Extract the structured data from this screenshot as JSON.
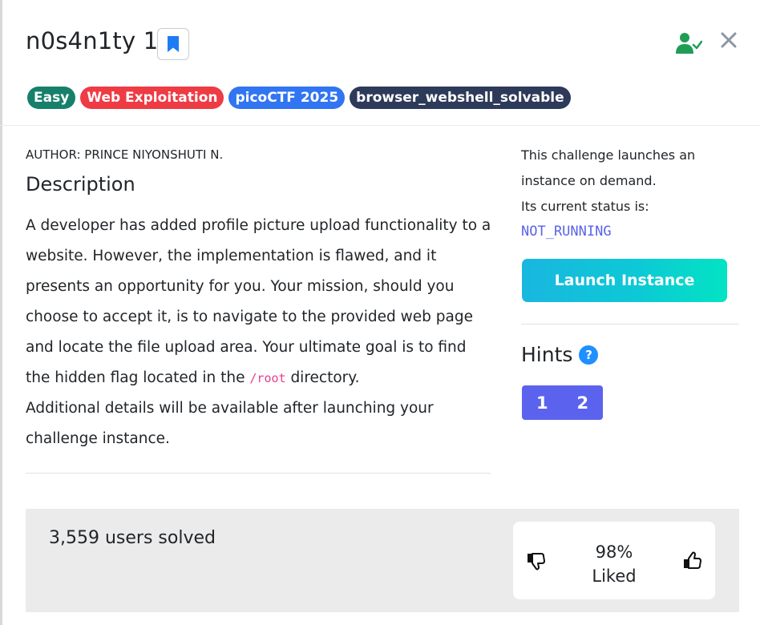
{
  "challenge": {
    "title": "n0s4n1ty 1",
    "tags": [
      {
        "label": "Easy",
        "color": "#17806b"
      },
      {
        "label": "Web Exploitation",
        "color": "#ee3b44"
      },
      {
        "label": "picoCTF 2025",
        "color": "#3175f2"
      },
      {
        "label": "browser_webshell_solvable",
        "color": "#2e3a59"
      }
    ],
    "author": "AUTHOR: PRINCE NIYONSHUTI N.",
    "description_heading": "Description",
    "description": {
      "part1": "A developer has added profile picture upload functionality to a website. However, the implementation is flawed, and it presents an opportunity for you. Your mission, should you choose to accept it, is to navigate to the provided web page and locate the file upload area. Your ultimate goal is to find the hidden flag located in the ",
      "code": "/root",
      "part2": " directory.",
      "part3": "Additional details will be available after launching your challenge instance."
    }
  },
  "instance": {
    "line1": "This challenge launches an",
    "line2": "instance on demand.",
    "line3": "Its current status is:",
    "status": "NOT_RUNNING",
    "launch_label": "Launch Instance"
  },
  "hints": {
    "heading": "Hints",
    "help_glyph": "?",
    "buttons": [
      "1",
      "2"
    ]
  },
  "footer": {
    "solved": "3,559 users solved",
    "liked_percent": "98%",
    "liked_label": "Liked"
  },
  "colors": {
    "status": "#5a63e6",
    "hint_buttons": "#5b63ee",
    "bookmark": "#1e7cf2",
    "user_check": "#1f9d55",
    "close": "#8a96a3"
  }
}
